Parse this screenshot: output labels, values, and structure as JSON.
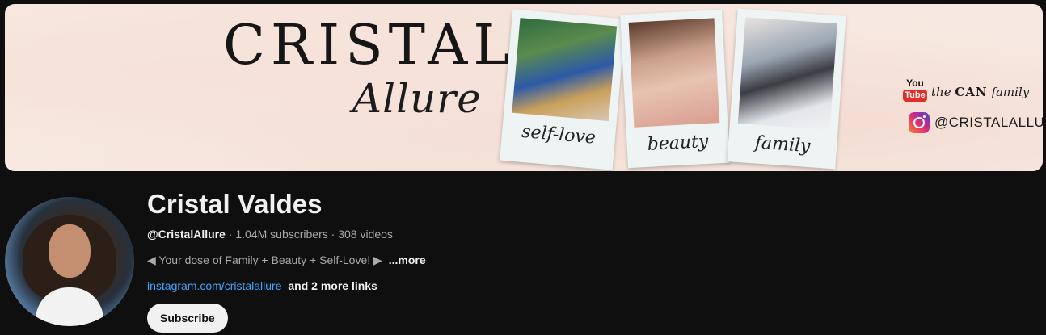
{
  "banner": {
    "brand_title": "CRISTAL",
    "brand_script": "Allure",
    "polaroids": [
      {
        "caption": "self-love"
      },
      {
        "caption": "beauty"
      },
      {
        "caption": "family"
      }
    ],
    "youtube": {
      "you": "You",
      "tube": "Tube",
      "text_pre": "the",
      "text_bold": "CAN",
      "text_post": "family"
    },
    "instagram": {
      "handle": "@CRISTALALLURE"
    }
  },
  "channel": {
    "name": "Cristal Valdes",
    "handle": "@CristalAllure",
    "subscribers": "1.04M subscribers",
    "videos": "308 videos",
    "description": "◀ Your dose of Family + Beauty + Self-Love! ▶",
    "more_label": "...more",
    "link": "instagram.com/cristalallure",
    "more_links": "and 2 more links",
    "subscribe_label": "Subscribe"
  },
  "colors": {
    "background": "#0f0f0f",
    "link": "#3ea6ff",
    "text": "#f1f1f1",
    "muted": "#aaaaaa"
  }
}
